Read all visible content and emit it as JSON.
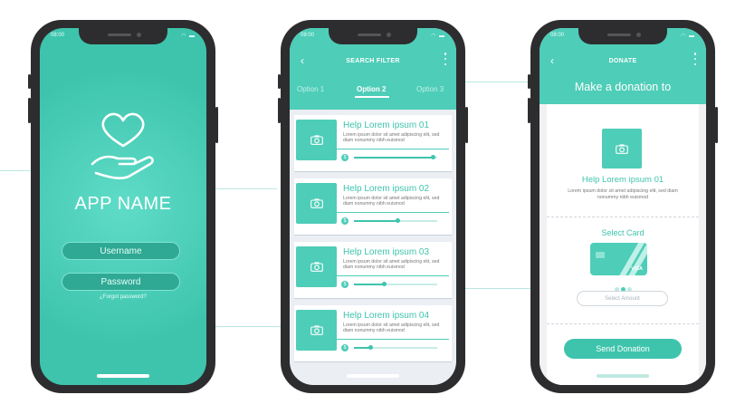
{
  "colors": {
    "teal": "#4ecdb8",
    "teal_dark": "#3ec4ad",
    "frame": "#2d2d2f"
  },
  "status": {
    "time": "08:00",
    "icons": "wifi-icon, battery-icon"
  },
  "login": {
    "app_name": "APP NAME",
    "username_label": "Username",
    "password_label": "Password",
    "forgot_label": "¿Forgot password?",
    "hero_icon": "heart-in-hand-icon"
  },
  "filter": {
    "title": "SEARCH FILTER",
    "tabs": [
      {
        "label": "Option 1",
        "active": false
      },
      {
        "label": "Option 2",
        "active": true
      },
      {
        "label": "Option 3",
        "active": false
      }
    ],
    "items": [
      {
        "title": "Help Lorem ipsum 01",
        "desc": "Lorem ipsum dolor sit amet adipiscing elit, sed diam nonummy nibh euismod",
        "progress": 0.95
      },
      {
        "title": "Help Lorem ipsum 02",
        "desc": "Lorem ipsum dolor sit amet adipiscing elit, sed diam nonummy nibh euismod",
        "progress": 0.52
      },
      {
        "title": "Help Lorem ipsum 03",
        "desc": "Lorem ipsum dolor sit amet adipiscing elit, sed diam nonummy nibh euismod",
        "progress": 0.36
      },
      {
        "title": "Help Lorem ipsum 04",
        "desc": "Lorem ipsum dolor sit amet adipiscing elit, sed diam nonummy nibh euismod",
        "progress": 0.2
      }
    ]
  },
  "donate": {
    "title": "DONATE",
    "heading": "Make a donation to",
    "item_title": "Help Lorem ipsum 01",
    "item_desc": "Lorem ipsum dolor sit amet adipiscing elit, sed diam nonummy nibh euismod",
    "select_card_label": "Select Card",
    "card_brand": "VISA",
    "amount_placeholder": "Select Amount",
    "send_label": "Send Donation"
  }
}
